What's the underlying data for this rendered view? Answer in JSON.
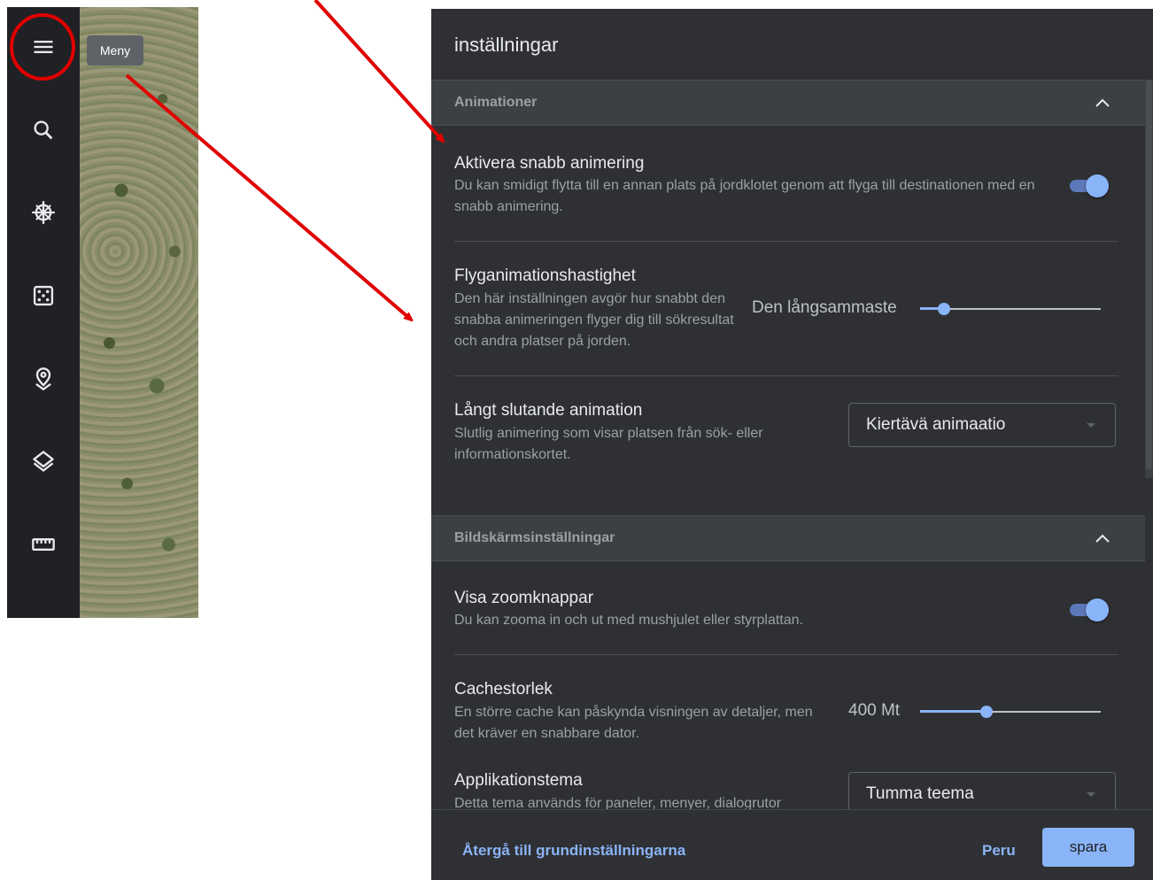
{
  "sidebar": {
    "tooltip": "Meny",
    "icons": [
      "menu-icon",
      "search-icon",
      "voyager-icon",
      "dice-icon",
      "pin-icon",
      "layers-icon",
      "ruler-icon"
    ]
  },
  "dialog": {
    "title": "inställningar",
    "sections": {
      "animations": {
        "header": "Animationer",
        "fast_animation": {
          "title": "Aktivera snabb animering",
          "desc": "Du kan smidigt flytta till en annan plats på jordklotet genom att flyga till destinationen med en snabb animering.",
          "enabled": true
        },
        "fly_speed": {
          "title": "Flyganimationshastighet",
          "desc": "Den här inställningen avgör hur snabbt den snabba animeringen flyger dig till sökresultat och andra platser på jorden.",
          "value_label": "Den långsammaste",
          "value": 0.13
        },
        "long_ending": {
          "title": "Långt slutande animation",
          "desc": "Slutlig animering som visar platsen från sök- eller informationskortet.",
          "selected": "Kiertävä animaatio"
        }
      },
      "display": {
        "header": "Bildskärmsinställningar",
        "zoom_buttons": {
          "title": "Visa zoomknappar",
          "desc": "Du kan zooma in och ut med mushjulet eller styrplattan.",
          "enabled": true
        },
        "cache": {
          "title": "Cachestorlek",
          "desc": "En större cache kan påskynda visningen av detaljer, men det kräver en snabbare dator.",
          "value_label": "400 Mt",
          "value": 0.37
        },
        "theme": {
          "title": "Applikationstema",
          "desc": "Detta tema används för paneler, menyer, dialogrutor",
          "selected": "Tumma teema"
        }
      }
    },
    "footer": {
      "reset": "Återgå till grundinställningarna",
      "cancel": "Peru",
      "save": "spara"
    }
  },
  "colors": {
    "dialog_bg": "#2f3033",
    "accent": "#8ab4f8",
    "annotation": "#e00000"
  }
}
